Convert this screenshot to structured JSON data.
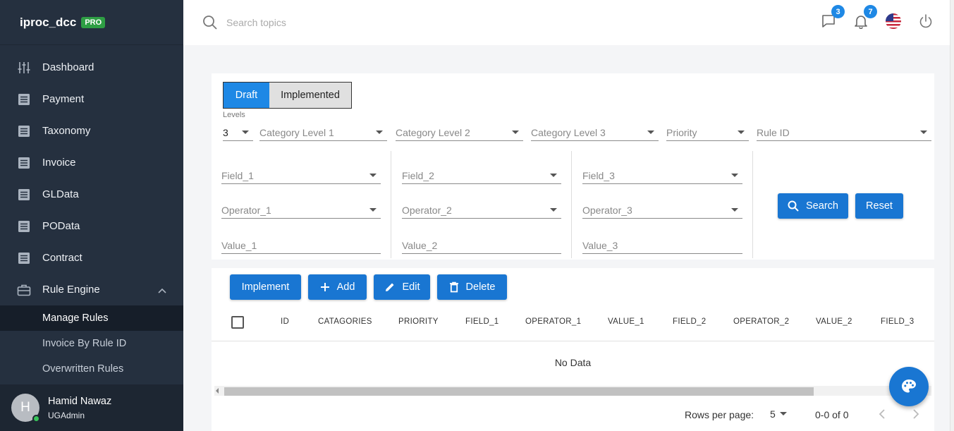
{
  "app": {
    "name": "iproc_dcc",
    "badge": "PRO"
  },
  "sidebar": {
    "items": [
      {
        "label": "Dashboard",
        "icon": "sliders-icon"
      },
      {
        "label": "Payment",
        "icon": "list-icon"
      },
      {
        "label": "Taxonomy",
        "icon": "list-icon"
      },
      {
        "label": "Invoice",
        "icon": "list-icon"
      },
      {
        "label": "GLData",
        "icon": "list-icon"
      },
      {
        "label": "POData",
        "icon": "list-icon"
      },
      {
        "label": "Contract",
        "icon": "list-icon"
      },
      {
        "label": "Rule Engine",
        "icon": "briefcase-icon"
      }
    ],
    "subitems": [
      {
        "label": "Manage Rules"
      },
      {
        "label": "Invoice By Rule ID"
      },
      {
        "label": "Overwritten Rules"
      }
    ],
    "user": {
      "initial": "H",
      "name": "Hamid Nawaz",
      "role": "UGAdmin"
    }
  },
  "header": {
    "search_placeholder": "Search topics",
    "messages_count": "3",
    "notifications_count": "7"
  },
  "filters": {
    "tabs": {
      "draft": "Draft",
      "implemented": "Implemented"
    },
    "levels_label": "Levels",
    "levels_value": "3",
    "category_1": "Category Level 1",
    "category_2": "Category Level 2",
    "category_3": "Category Level 3",
    "priority": "Priority",
    "rule_id": "Rule ID",
    "field_1": "Field_1",
    "field_2": "Field_2",
    "field_3": "Field_3",
    "operator_1": "Operator_1",
    "operator_2": "Operator_2",
    "operator_3": "Operator_3",
    "value_1": "Value_1",
    "value_2": "Value_2",
    "value_3": "Value_3",
    "search_button": "Search",
    "reset_button": "Reset"
  },
  "toolbar": {
    "implement": "Implement",
    "add": "Add",
    "edit": "Edit",
    "delete": "Delete"
  },
  "table": {
    "columns": [
      "ID",
      "CATAGORIES",
      "PRIORITY",
      "FIELD_1",
      "OPERATOR_1",
      "VALUE_1",
      "FIELD_2",
      "OPERATOR_2",
      "VALUE_2",
      "FIELD_3"
    ],
    "empty_text": "No Data",
    "rows_per_page_label": "Rows per page:",
    "rows_per_page": "5",
    "range": "0-0 of 0"
  },
  "colors": {
    "sidebar": "#25303f",
    "accent": "#1976d2",
    "pro_badge": "#2e9e44"
  }
}
